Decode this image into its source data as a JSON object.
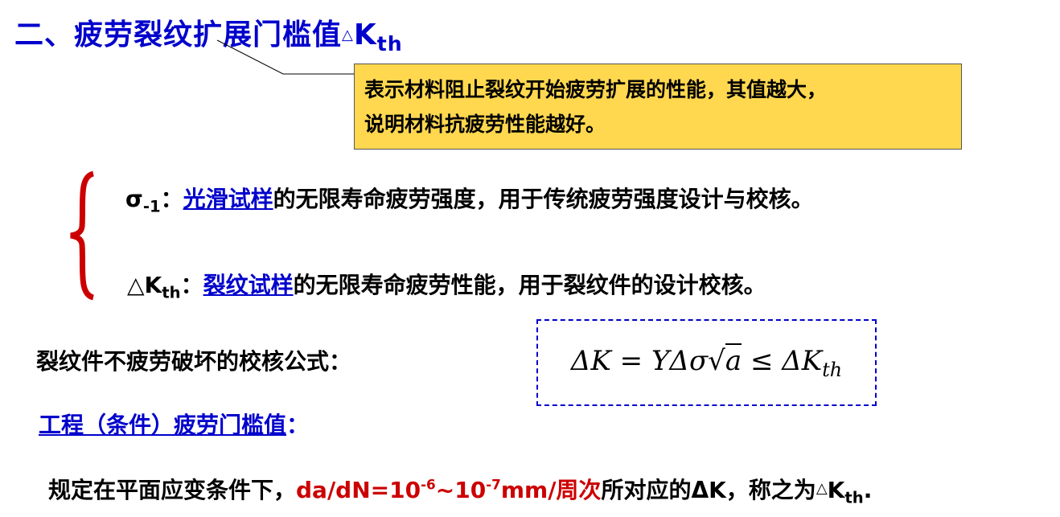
{
  "title": {
    "prefix": "二、疲劳裂纹扩展门槛值",
    "symbol_tri": "△",
    "symbol_k": "K",
    "symbol_sub": "th"
  },
  "callout": {
    "line1": "表示材料阻止裂纹开始疲劳扩展的性能，其值越大，",
    "line2": "说明材料抗疲劳性能越好。"
  },
  "items": [
    {
      "sym": "σ",
      "sub": "-1",
      "colon": "：",
      "link": "光滑试样",
      "text": "的无限寿命疲劳强度，用于传统疲劳强度设计与校核。"
    },
    {
      "sym": "△K",
      "sub": "th",
      "colon": "：",
      "link": "裂纹试样",
      "text": "的无限寿命疲劳性能，用于裂纹件的设计校核。"
    }
  ],
  "check_label": "裂纹件不疲劳破坏的校核公式：",
  "formula": {
    "lhs": "ΔK = YΔσ",
    "sqrt_arg": "a",
    "rhs": "≤ ΔK",
    "rhs_sub": "th"
  },
  "engineering_label": "工程（条件）疲劳门槛值",
  "engineering_colon": "：",
  "definition": {
    "before": "规定在平面应变条件下，",
    "red1": "da/dN=10",
    "exp1": "-6",
    "red2": "~10",
    "exp2": "-7",
    "red3": "mm/周次",
    "after": "所对应的ΔK，称之为",
    "tri": "△",
    "k": "K",
    "sub": "th",
    "end": "."
  },
  "colors": {
    "title": "#0000cc",
    "callout_bg": "#ffd84f",
    "brace": "#cc0000",
    "highlight": "#cc0000"
  }
}
